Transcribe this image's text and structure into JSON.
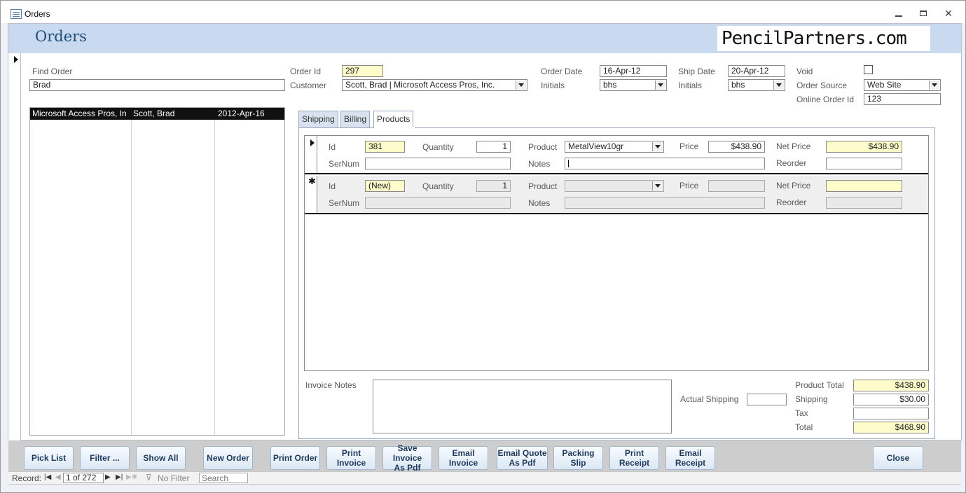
{
  "window": {
    "title": "Orders"
  },
  "header": {
    "title": "Orders",
    "logo_text": "PencilPartners.com"
  },
  "find": {
    "label": "Find Order",
    "value": "Brad"
  },
  "order": {
    "id_label": "Order Id",
    "id_value": "297",
    "customer_label": "Customer",
    "customer_value": "Scott, Brad | Microsoft Access Pros, Inc.",
    "order_date_label": "Order Date",
    "order_date_value": "16-Apr-12",
    "initials_label": "Initials",
    "initials_value": "bhs",
    "ship_date_label": "Ship Date",
    "ship_date_value": "20-Apr-12",
    "ship_initials_label": "Initials",
    "ship_initials_value": "bhs",
    "void_label": "Void",
    "source_label": "Order Source",
    "source_value": "Web Site",
    "online_id_label": "Online Order Id",
    "online_id_value": "123"
  },
  "results": [
    {
      "company": "Microsoft Access Pros, In",
      "name": "Scott, Brad",
      "date": "2012-Apr-16"
    }
  ],
  "tabs": [
    "Shipping",
    "Billing",
    "Products"
  ],
  "line_items": {
    "labels": {
      "id": "Id",
      "quantity": "Quantity",
      "product": "Product",
      "price": "Price",
      "net_price": "Net Price",
      "sernum": "SerNum",
      "notes": "Notes",
      "reorder": "Reorder"
    },
    "row1": {
      "id": "381",
      "quantity": "1",
      "product": "MetalView10gr",
      "price": "$438.90",
      "net_price": "$438.90",
      "sernum": "",
      "notes": "",
      "reorder": ""
    },
    "new_row": {
      "id": "(New)",
      "quantity": "1"
    },
    "new_row_marker": "✱"
  },
  "invoice": {
    "notes_label": "Invoice Notes",
    "actual_shipping_label": "Actual Shipping",
    "product_total_label": "Product Total",
    "product_total": "$438.90",
    "shipping_label": "Shipping",
    "shipping": "$30.00",
    "tax_label": "Tax",
    "tax": "",
    "total_label": "Total",
    "total": "$468.90"
  },
  "buttons": {
    "pick_list": "Pick List",
    "filter": "Filter ...",
    "show_all": "Show All",
    "new_order": "New Order",
    "print_order": "Print Order",
    "print_invoice": "Print\nInvoice",
    "save_invoice_pdf": "Save Invoice\nAs Pdf",
    "email_invoice": "Email\nInvoice",
    "email_quote_pdf": "Email Quote\nAs Pdf",
    "packing_slip": "Packing Slip",
    "print_receipt": "Print\nReceipt",
    "email_receipt": "Email\nReceipt",
    "close": "Close"
  },
  "nav": {
    "record_label": "Record:",
    "position": "1 of 272",
    "filter_label": "No Filter",
    "search_placeholder": "Search"
  },
  "colors": {
    "header_band": "#c9daf0",
    "title": "#1f4e7a",
    "footer_band": "#cdcdcd",
    "highlight_field": "#fffccb"
  }
}
